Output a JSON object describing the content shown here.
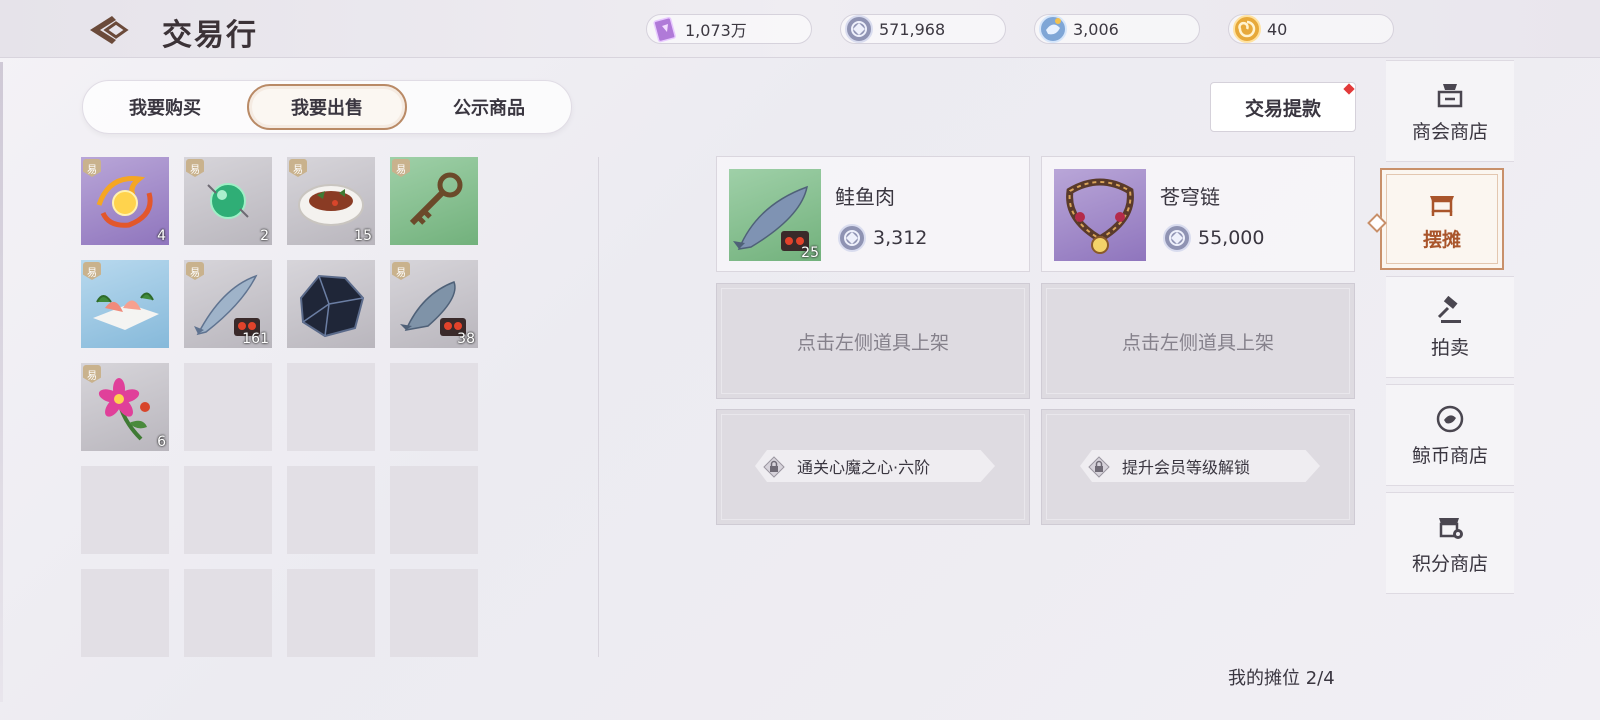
{
  "header": {
    "title": "交易行",
    "currencies": [
      {
        "icon": "crystal-card-icon",
        "value": "1,073万"
      },
      {
        "icon": "silver-coin-icon",
        "value": "571,968"
      },
      {
        "icon": "whale-coin-icon",
        "value": "3,006"
      },
      {
        "icon": "gold-swirl-coin-icon",
        "value": "40"
      }
    ]
  },
  "tabs": [
    {
      "label": "我要购买",
      "active": false
    },
    {
      "label": "我要出售",
      "active": true
    },
    {
      "label": "公示商品",
      "active": false
    }
  ],
  "tradable_tag": "易",
  "inventory": [
    {
      "icon": "phoenix-orb-icon",
      "count": "4",
      "bg": "purple",
      "tradable": true
    },
    {
      "icon": "green-orb-icon",
      "count": "2",
      "bg": "gray",
      "tradable": true
    },
    {
      "icon": "fish-dish-icon",
      "count": "15",
      "bg": "gray",
      "tradable": true
    },
    {
      "icon": "bronze-key-icon",
      "count": "",
      "bg": "green",
      "tradable": true
    },
    {
      "icon": "sashimi-platter-icon",
      "count": "",
      "bg": "blue",
      "tradable": true
    },
    {
      "icon": "slender-fish-icon",
      "count": "161",
      "bg": "gray",
      "tradable": true
    },
    {
      "icon": "dark-ore-icon",
      "count": "",
      "bg": "gray",
      "tradable": false
    },
    {
      "icon": "river-fish-icon",
      "count": "38",
      "bg": "gray",
      "tradable": true
    },
    {
      "icon": "pink-flower-icon",
      "count": "6",
      "bg": "gray",
      "tradable": true
    }
  ],
  "withdraw_button": "交易提款",
  "listings": [
    {
      "name": "鲑鱼肉",
      "price": "3,312",
      "count": "25",
      "icon": "salmon-icon"
    },
    {
      "name": "苍穹链",
      "price": "55,000",
      "count": "",
      "icon": "sky-necklace-icon"
    }
  ],
  "empty_slot_text": "点击左侧道具上架",
  "locked_slots": [
    {
      "text": "通关心魔之心·六阶"
    },
    {
      "text": "提升会员等级解锁"
    }
  ],
  "stall_status": "我的摊位 2/4",
  "side_menu": [
    {
      "label": "商会商店",
      "icon": "guild-shop-icon",
      "active": false
    },
    {
      "label": "摆摊",
      "icon": "stall-icon",
      "active": true
    },
    {
      "label": "拍卖",
      "icon": "gavel-icon",
      "active": false
    },
    {
      "label": "鲸币商店",
      "icon": "whale-shop-icon",
      "active": false
    },
    {
      "label": "积分商店",
      "icon": "points-shop-icon",
      "active": false
    }
  ]
}
